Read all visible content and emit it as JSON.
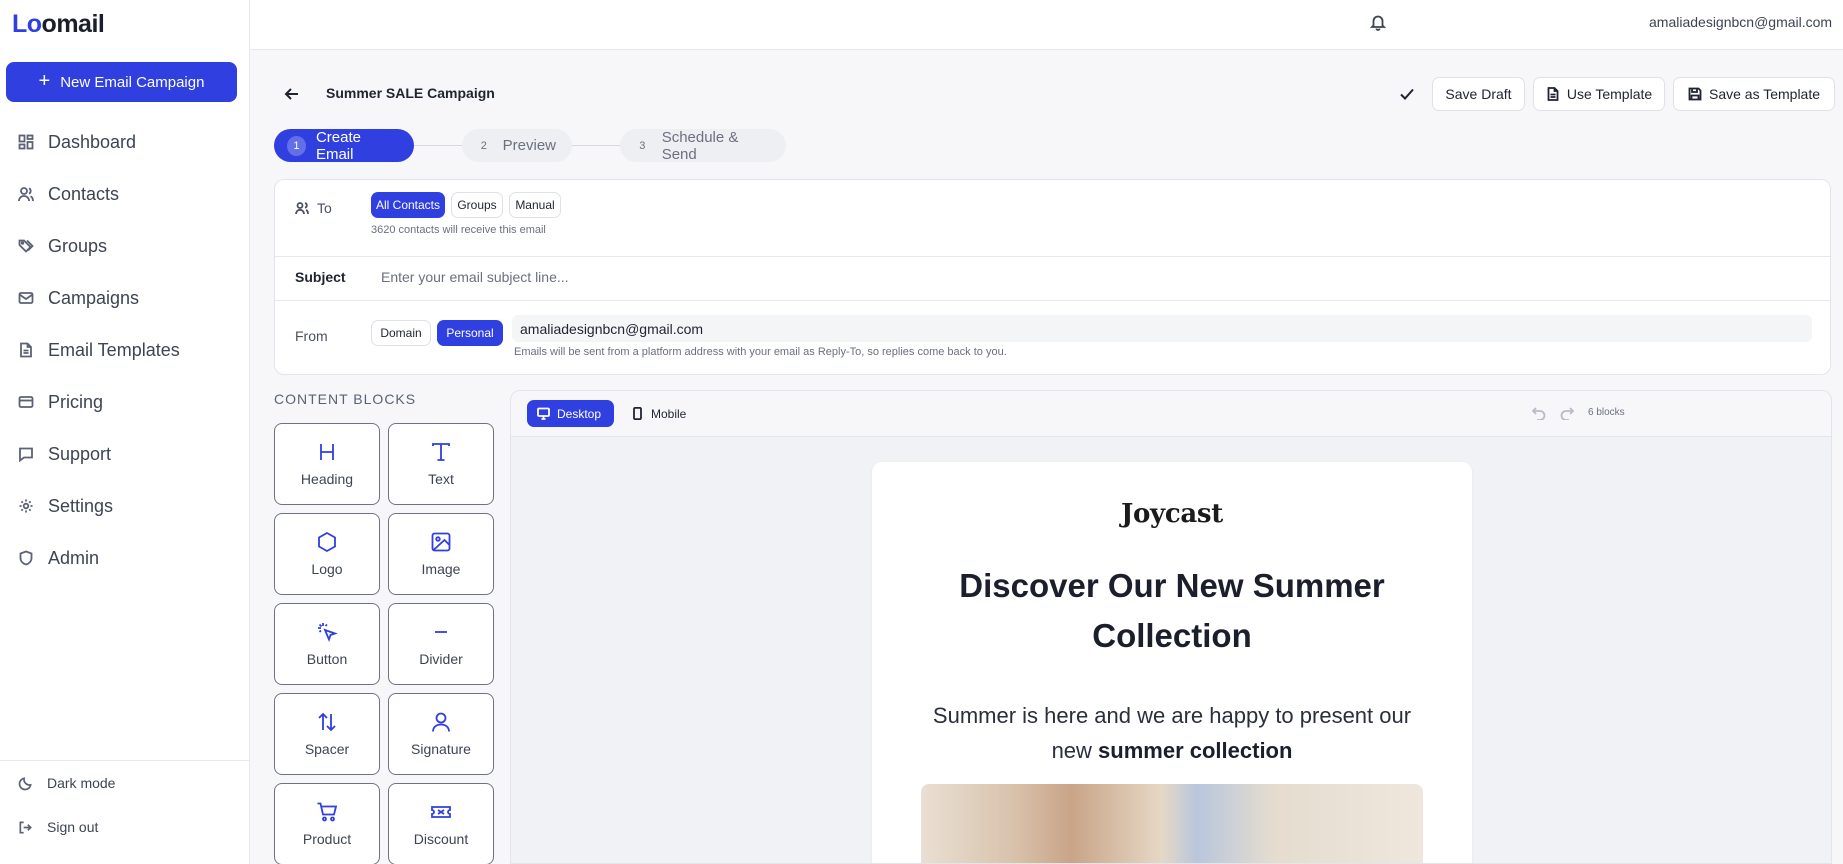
{
  "app": {
    "logo_prefix": "Lo",
    "logo_rest": "omail",
    "user_email": "amaliadesignbcn@gmail.com"
  },
  "sidebar": {
    "new_button": "New Email Campaign",
    "items": [
      {
        "label": "Dashboard",
        "icon": "dashboard-icon"
      },
      {
        "label": "Contacts",
        "icon": "users-icon"
      },
      {
        "label": "Groups",
        "icon": "tags-icon"
      },
      {
        "label": "Campaigns",
        "icon": "mail-icon"
      },
      {
        "label": "Email Templates",
        "icon": "file-icon"
      },
      {
        "label": "Pricing",
        "icon": "credit-card-icon"
      },
      {
        "label": "Support",
        "icon": "message-icon"
      },
      {
        "label": "Settings",
        "icon": "gear-icon"
      },
      {
        "label": "Admin",
        "icon": "shield-icon"
      }
    ],
    "dark_mode": "Dark mode",
    "sign_out": "Sign out"
  },
  "header": {
    "campaign_title": "Summer SALE Campaign",
    "save_draft": "Save Draft",
    "use_template": "Use Template",
    "save_as_template": "Save as Template"
  },
  "steps": [
    {
      "num": "1",
      "label": "Create Email"
    },
    {
      "num": "2",
      "label": "Preview"
    },
    {
      "num": "3",
      "label": "Schedule & Send"
    }
  ],
  "form": {
    "to_label": "To",
    "to_options": [
      "All Contacts",
      "Groups",
      "Manual"
    ],
    "recipients_note": "3620 contacts will receive this email",
    "subject_label": "Subject",
    "subject_placeholder": "Enter your email subject line...",
    "subject_value": "",
    "from_label": "From",
    "from_options": [
      "Domain",
      "Personal"
    ],
    "from_value": "amaliadesignbcn@gmail.com",
    "from_note": "Emails will be sent from a platform address with your email as Reply-To, so replies come back to you."
  },
  "content_blocks": {
    "title": "CONTENT BLOCKS",
    "items": [
      {
        "label": "Heading",
        "icon": "heading-icon"
      },
      {
        "label": "Text",
        "icon": "text-icon"
      },
      {
        "label": "Logo",
        "icon": "hexagon-icon"
      },
      {
        "label": "Image",
        "icon": "image-icon"
      },
      {
        "label": "Button",
        "icon": "cursor-click-icon"
      },
      {
        "label": "Divider",
        "icon": "minus-icon"
      },
      {
        "label": "Spacer",
        "icon": "arrows-up-down-icon"
      },
      {
        "label": "Signature",
        "icon": "user-icon"
      },
      {
        "label": "Product",
        "icon": "cart-icon"
      },
      {
        "label": "Discount",
        "icon": "ticket-icon"
      }
    ]
  },
  "canvas": {
    "desktop": "Desktop",
    "mobile": "Mobile",
    "blocks_count": "6 blocks"
  },
  "email": {
    "brand": "Joycast",
    "heading": "Discover Our New Summer Collection",
    "text_before": "Summer is here and we are happy to present our new ",
    "text_bold": "summer collection"
  },
  "colors": {
    "accent": "#2f3fe0",
    "sidebar_text": "#3d4454",
    "canvas_bg": "#f1f2f5"
  }
}
